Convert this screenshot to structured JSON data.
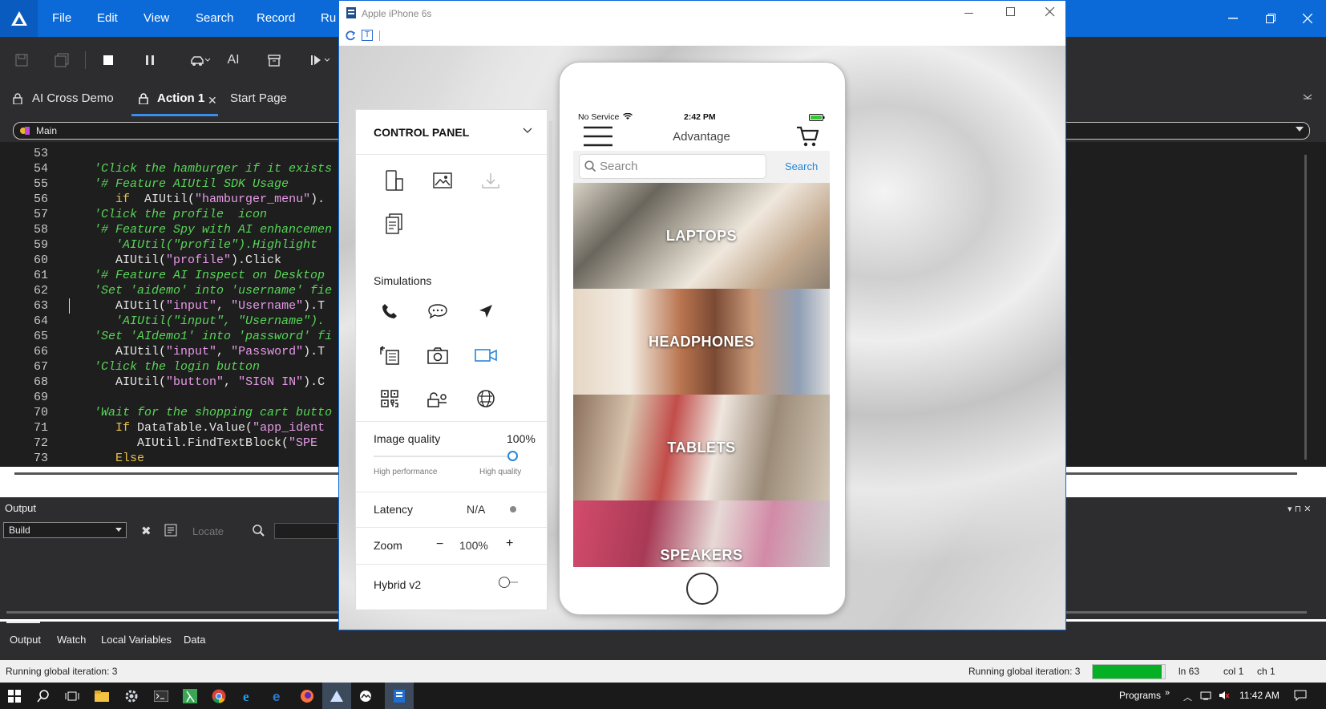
{
  "ide": {
    "menu": [
      "File",
      "Edit",
      "View",
      "Search",
      "Record",
      "Ru"
    ],
    "tabs": {
      "t1": "AI Cross Demo",
      "t2": "Action 1",
      "t3": "Start Page"
    },
    "toolbar_ai_label": "AI",
    "routine": "Main",
    "code_lines": [
      {
        "n": "53",
        "indent": "",
        "parts": []
      },
      {
        "n": "54",
        "indent": "   ",
        "parts": [
          {
            "c": "cmt",
            "t": "'Click the hamburger if it exists"
          }
        ]
      },
      {
        "n": "55",
        "indent": "   ",
        "parts": [
          {
            "c": "cmt",
            "t": "'# Feature AIUtil SDK Usage"
          }
        ]
      },
      {
        "n": "56",
        "indent": "      ",
        "parts": [
          {
            "c": "kw",
            "t": "if"
          },
          {
            "c": "def",
            "t": "  AIUtil("
          },
          {
            "c": "str",
            "t": "\"hamburger_menu\""
          },
          {
            "c": "def",
            "t": ")."
          }
        ]
      },
      {
        "n": "57",
        "indent": "   ",
        "parts": [
          {
            "c": "cmt",
            "t": "'Click the profile  icon"
          }
        ]
      },
      {
        "n": "58",
        "indent": "   ",
        "parts": [
          {
            "c": "cmt",
            "t": "'# Feature Spy with AI enhancemen"
          }
        ]
      },
      {
        "n": "59",
        "indent": "      ",
        "parts": [
          {
            "c": "cmt",
            "t": "'AIUtil(\"profile\").Highlight"
          }
        ]
      },
      {
        "n": "60",
        "indent": "      ",
        "parts": [
          {
            "c": "def",
            "t": "AIUtil("
          },
          {
            "c": "str",
            "t": "\"profile\""
          },
          {
            "c": "def",
            "t": ").Click"
          }
        ]
      },
      {
        "n": "61",
        "indent": "   ",
        "parts": [
          {
            "c": "cmt",
            "t": "'# Feature AI Inspect on Desktop "
          }
        ]
      },
      {
        "n": "62",
        "indent": "   ",
        "parts": [
          {
            "c": "cmt",
            "t": "'Set 'aidemo' into 'username' fie"
          }
        ]
      },
      {
        "n": "63",
        "indent": "      ",
        "parts": [
          {
            "c": "def",
            "t": "AIUtil("
          },
          {
            "c": "str",
            "t": "\"input\""
          },
          {
            "c": "def",
            "t": ", "
          },
          {
            "c": "str",
            "t": "\"Username\""
          },
          {
            "c": "def",
            "t": ").T"
          }
        ]
      },
      {
        "n": "64",
        "indent": "      ",
        "parts": [
          {
            "c": "cmt",
            "t": "'AIUtil(\"input\", \"Username\")."
          }
        ]
      },
      {
        "n": "65",
        "indent": "   ",
        "parts": [
          {
            "c": "cmt",
            "t": "'Set 'AIdemo1' into 'password' fi"
          }
        ]
      },
      {
        "n": "66",
        "indent": "      ",
        "parts": [
          {
            "c": "def",
            "t": "AIUtil("
          },
          {
            "c": "str",
            "t": "\"input\""
          },
          {
            "c": "def",
            "t": ", "
          },
          {
            "c": "str",
            "t": "\"Password\""
          },
          {
            "c": "def",
            "t": ").T"
          }
        ]
      },
      {
        "n": "67",
        "indent": "   ",
        "parts": [
          {
            "c": "cmt",
            "t": "'Click the login button"
          }
        ]
      },
      {
        "n": "68",
        "indent": "      ",
        "parts": [
          {
            "c": "def",
            "t": "AIUtil("
          },
          {
            "c": "str",
            "t": "\"button\""
          },
          {
            "c": "def",
            "t": ", "
          },
          {
            "c": "str",
            "t": "\"SIGN IN\""
          },
          {
            "c": "def",
            "t": ").C"
          }
        ]
      },
      {
        "n": "69",
        "indent": "",
        "parts": []
      },
      {
        "n": "70",
        "indent": "   ",
        "parts": [
          {
            "c": "cmt",
            "t": "'Wait for the shopping cart butto"
          }
        ]
      },
      {
        "n": "71",
        "indent": "      ",
        "parts": [
          {
            "c": "kw",
            "t": "If"
          },
          {
            "c": "def",
            "t": " DataTable.Value("
          },
          {
            "c": "str",
            "t": "\"app_ident"
          }
        ]
      },
      {
        "n": "72",
        "indent": "         ",
        "parts": [
          {
            "c": "def",
            "t": "AIUtil.FindTextBlock("
          },
          {
            "c": "str",
            "t": "\"SPE"
          }
        ]
      },
      {
        "n": "73",
        "indent": "      ",
        "parts": [
          {
            "c": "kw",
            "t": "Else"
          }
        ]
      }
    ],
    "output": {
      "title": "Output",
      "select": "Build",
      "locate": "Locate"
    },
    "bottom_tabs": {
      "b1": "Output",
      "b2": "Watch",
      "b3": "Local Variables",
      "b4": "Data"
    },
    "status": {
      "left": "Running global iteration: 3",
      "right": "Running global iteration: 3",
      "progress": 0.95,
      "ln": "ln 63",
      "col": "col 1",
      "ch": "ch 1"
    },
    "taskbar": {
      "programs": "Programs",
      "time": "11:42 AM"
    }
  },
  "device": {
    "window_title": "Apple iPhone 6s",
    "control_panel": {
      "title": "CONTROL PANEL",
      "simulations": "Simulations",
      "image_quality_label": "Image quality",
      "image_quality_value": "100%",
      "image_quality_level": 1.0,
      "hp": "High performance",
      "hq": "High quality",
      "latency_label": "Latency",
      "latency_value": "N/A",
      "zoom_label": "Zoom",
      "zoom_minus": "−",
      "zoom_value": "100%",
      "zoom_plus": "+",
      "hybrid_label": "Hybrid v2"
    },
    "phone": {
      "carrier": "No Service",
      "time": "2:42 PM",
      "app_title": "Advantage",
      "search_placeholder": "Search",
      "search_button": "Search",
      "categories": {
        "c1": "LAPTOPS",
        "c2": "HEADPHONES",
        "c3": "TABLETS",
        "c4": "SPEAKERS"
      }
    }
  },
  "colors": {
    "accent": "#0b6ad8",
    "ide_dark": "#2d2d30",
    "editor_bg": "#1e1e1e",
    "comment": "#57d657",
    "string": "#e89ae8",
    "keyword": "#e8c04a",
    "progress": "#06b025",
    "link": "#2a86d8"
  }
}
